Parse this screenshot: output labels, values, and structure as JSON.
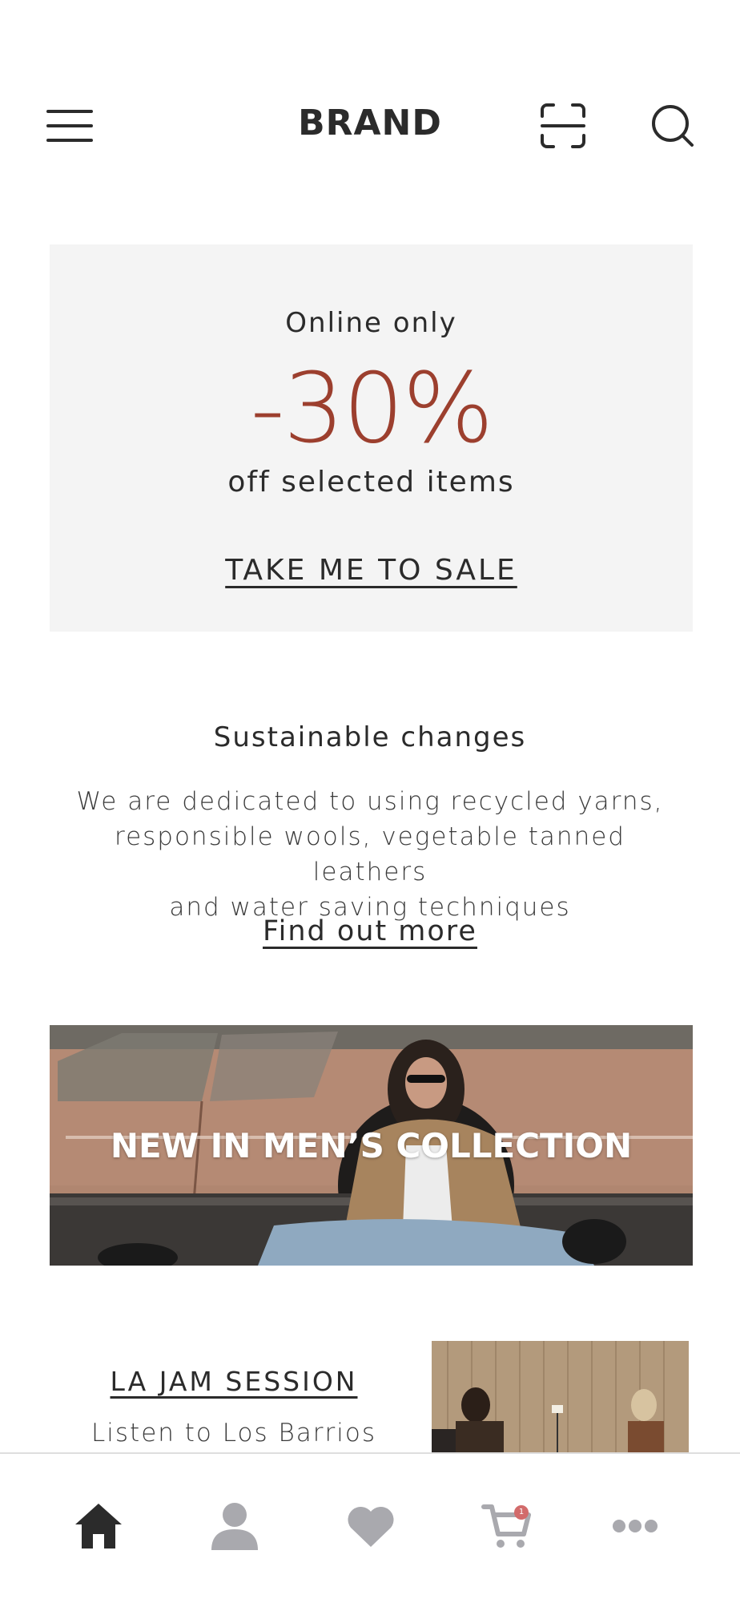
{
  "header": {
    "brand": "BRAND",
    "icons": [
      "menu-icon",
      "scan-icon",
      "search-icon"
    ]
  },
  "promo": {
    "top_text": "Online only",
    "discount": "-30%",
    "sub_text": "off selected items",
    "cta": "TAKE ME TO SALE",
    "accent_color": "#9c3f2e"
  },
  "sustainable": {
    "title": "Sustainable changes",
    "body_lines": [
      "We are dedicated to using recycled yarns,",
      "responsible wools, vegetable tanned leathers",
      "and water saving techniques"
    ],
    "link": "Find out more"
  },
  "banner": {
    "title": "NEW IN MEN’S COLLECTION"
  },
  "jam": {
    "title": "LA JAM SESSION",
    "subtitle": "Listen to Los Barrios"
  },
  "bottom_nav": {
    "items": [
      "home-icon",
      "profile-icon",
      "heart-icon",
      "cart-icon",
      "more-icon"
    ],
    "active": "home-icon",
    "cart_badge": "1"
  }
}
